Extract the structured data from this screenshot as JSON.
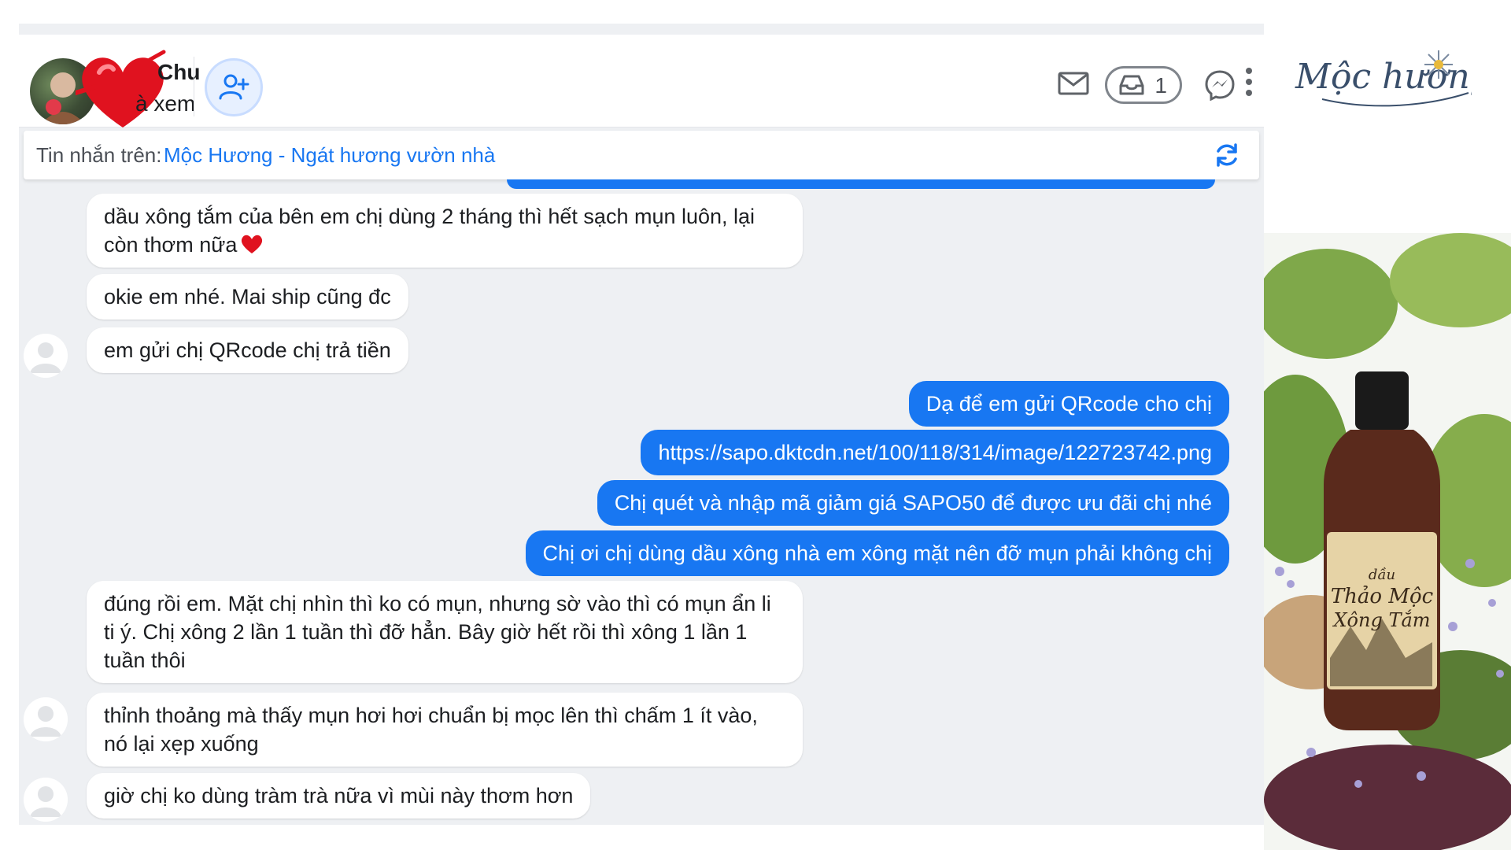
{
  "header": {
    "user_name": "Chu",
    "view_label": "à xem",
    "inbox_count": "1"
  },
  "context_bar": {
    "prefix": "Tin nhắn trên:",
    "page_name": "Mộc Hương - Ngát hương vườn nhà"
  },
  "messages": [
    {
      "direction": "in",
      "text": "dầu xông tắm của bên em chị dùng 2 tháng thì hết sạch mụn luôn, lại còn thơm nữa",
      "has_heart": true
    },
    {
      "direction": "in",
      "text": "okie em nhé. Mai ship cũng đc"
    },
    {
      "direction": "in",
      "text": "em gửi chị QRcode chị trả tiền"
    },
    {
      "direction": "out",
      "text": "Dạ để em gửi QRcode cho chị"
    },
    {
      "direction": "out",
      "text": "https://sapo.dktcdn.net/100/118/314/image/122723742.png"
    },
    {
      "direction": "out",
      "text": "Chị quét và nhập mã giảm giá SAPO50 để được ưu đãi chị nhé"
    },
    {
      "direction": "out",
      "text": "Chị ơi chị dùng dầu xông nhà em xông mặt nên đỡ mụn phải không chị"
    },
    {
      "direction": "in",
      "text": "đúng rồi em. Mặt chị nhìn thì ko có mụn, nhưng sờ vào thì có mụn ẩn li ti ý. Chị xông 2 lần 1 tuần thì đỡ hẳn. Bây giờ hết rồi thì xông 1 lần 1 tuần thôi"
    },
    {
      "direction": "in",
      "text": "thỉnh thoảng mà thấy mụn hơi hơi chuẩn bị mọc lên thì chấm 1 ít vào, nó lại xẹp xuống"
    },
    {
      "direction": "in",
      "text": "giờ chị ko dùng tràm trà nữa vì mùi này thơm hơn"
    }
  ],
  "brand": {
    "logo_text": "Mộc hương",
    "label_line1": "dầu",
    "label_line2": "Thảo Mộc",
    "label_line3": "Xông Tắm"
  },
  "icons": {
    "add_friend": "person-plus-icon",
    "mail": "mail-icon",
    "inbox": "inbox-tray-icon",
    "messenger": "messenger-icon",
    "more": "vertical-dots-icon",
    "refresh": "refresh-icon"
  },
  "colors": {
    "accent_blue": "#1877f2",
    "chat_background": "#eef0f3",
    "heart_red": "#e0121f"
  }
}
